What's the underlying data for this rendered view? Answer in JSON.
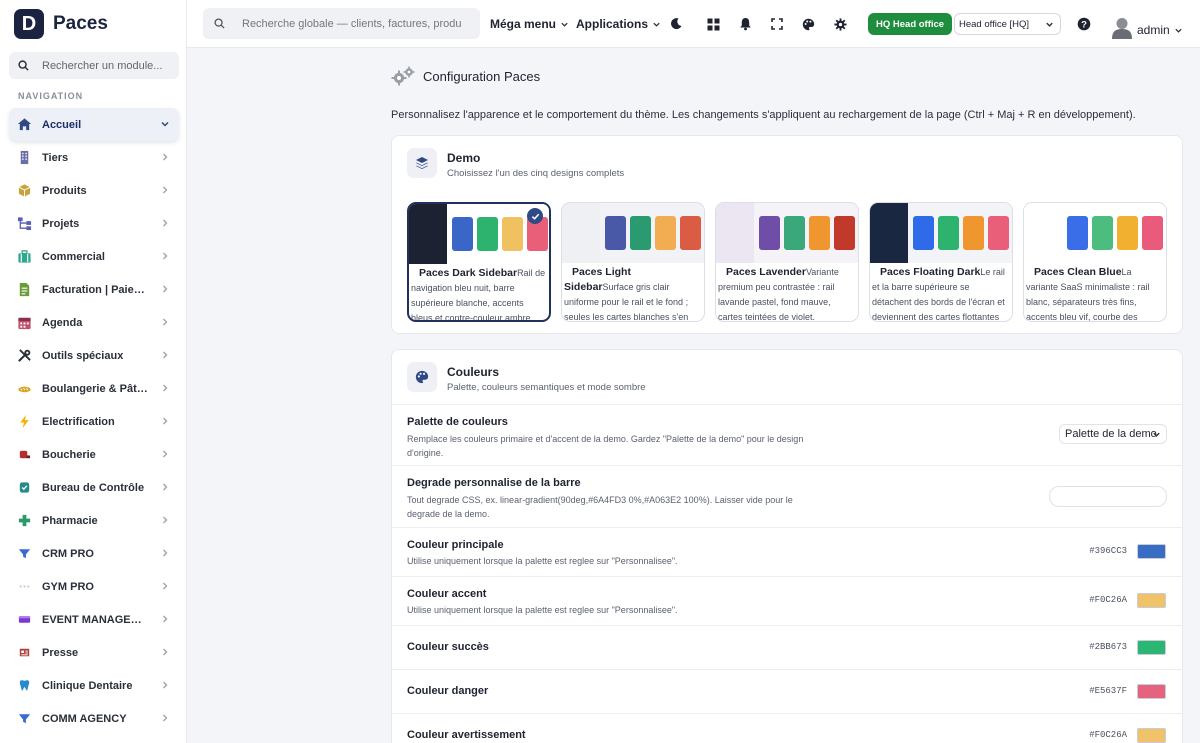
{
  "brand": {
    "logo_letter": "D",
    "name": "Paces"
  },
  "sidebar": {
    "search_placeholder": "Rechercher un module...",
    "section_label": "NAVIGATION",
    "items": [
      {
        "label": "Accueil",
        "icon": "home-icon",
        "color": "#2f4a86"
      },
      {
        "label": "Tiers",
        "icon": "building-icon",
        "color": "#6b6fa8"
      },
      {
        "label": "Produits",
        "icon": "box-icon",
        "color": "#c8a23a"
      },
      {
        "label": "Projets",
        "icon": "sitemap-icon",
        "color": "#5a5fb0"
      },
      {
        "label": "Commercial",
        "icon": "briefcase-icon",
        "color": "#2fa98e"
      },
      {
        "label": "Facturation | Paiement",
        "icon": "invoice-icon",
        "color": "#6a9c3a"
      },
      {
        "label": "Agenda",
        "icon": "calendar-icon",
        "color": "#c0506a"
      },
      {
        "label": "Outils spéciaux",
        "icon": "tools-icon",
        "color": "#2a2f3a"
      },
      {
        "label": "Boulangerie & Pâtisserie",
        "icon": "bread-icon",
        "color": "#d9a520"
      },
      {
        "label": "Electrification",
        "icon": "bolt-icon",
        "color": "#f2b400"
      },
      {
        "label": "Boucherie",
        "icon": "meat-icon",
        "color": "#b03030"
      },
      {
        "label": "Bureau de Contrôle",
        "icon": "shield-icon",
        "color": "#2a8a8a"
      },
      {
        "label": "Pharmacie",
        "icon": "plus-cross-icon",
        "color": "#2a9a6a"
      },
      {
        "label": "CRM PRO",
        "icon": "funnel-icon",
        "color": "#3a6ad0"
      },
      {
        "label": "GYM PRO",
        "icon": "dots-icon",
        "color": "#c8ccd6"
      },
      {
        "label": "EVENT MANAGEMENT",
        "icon": "ticket-icon",
        "color": "#7a3ad0"
      },
      {
        "label": "Presse",
        "icon": "newspaper-icon",
        "color": "#b04040"
      },
      {
        "label": "Clinique Dentaire",
        "icon": "tooth-icon",
        "color": "#2a8ad0"
      },
      {
        "label": "COMM AGENCY",
        "icon": "filter-icon",
        "color": "#3a6ad0"
      }
    ]
  },
  "topbar": {
    "search_placeholder": "Recherche globale — clients, factures, produits…",
    "mega_menu": "Méga menu",
    "applications": "Applications",
    "icons": [
      "moon-icon",
      "grid-icon",
      "bell-icon",
      "fullscreen-icon",
      "palette-icon",
      "gear-icon"
    ],
    "entity_badge": "HQ Head office",
    "entity_select": "Head office [HQ]",
    "user": "admin"
  },
  "page": {
    "title": "Configuration Paces",
    "description": "Personnalisez l'apparence et le comportement du thème. Les changements s'appliquent au rechargement de la page (Ctrl + Maj + R en développement)."
  },
  "demo": {
    "title": "Demo",
    "subtitle": "Choisissez l'un des cinq designs complets",
    "designs": [
      {
        "name": "Paces Dark Sidebar",
        "desc": "Rail de navigation bleu nuit, barre supérieure blanche, accents bleus et contre-couleur ambre.",
        "rail": "#1c2231",
        "bg": "#ffffff",
        "swatches": [
          "#3a67c7",
          "#2eb36f",
          "#f0c160",
          "#e95f7a"
        ],
        "selected": true
      },
      {
        "name": "Paces Light Sidebar",
        "desc": "Surface gris clair uniforme pour le rail et le fond ; seules les cartes blanches s'en détachent. Indigo et orange.",
        "rail": "#eef0f4",
        "bg": "#f2f3f6",
        "swatches": [
          "#4a58a8",
          "#2a9a70",
          "#f2ad52",
          "#db5c45"
        ],
        "selected": false
      },
      {
        "name": "Paces Lavender",
        "desc": "Variante premium peu contrastée : rail lavande pastel, fond mauve, cartes teintées de violet.",
        "rail": "#ece6f2",
        "bg": "#f5f2f8",
        "swatches": [
          "#6f4ea8",
          "#3aa87a",
          "#f0962e",
          "#c0392b"
        ],
        "selected": false
      },
      {
        "name": "Paces Floating Dark",
        "desc": "Le rail et la barre supérieure se détachent des bords de l'écran et deviennent des cartes flottantes arrondies.",
        "rail": "#1a2740",
        "bg": "#f2f4f8",
        "swatches": [
          "#2f6ae8",
          "#2eb36f",
          "#f0962e",
          "#e95f7a"
        ],
        "selected": false
      },
      {
        "name": "Paces Clean Blue",
        "desc": "La variante SaaS minimaliste : rail blanc, séparateurs très fins, accents bleu vif, courbe des ventes verte.",
        "rail": "#ffffff",
        "bg": "#ffffff",
        "swatches": [
          "#3a6ee8",
          "#4cbd7e",
          "#f2b030",
          "#ea5a7a"
        ],
        "selected": false
      }
    ]
  },
  "colors": {
    "title": "Couleurs",
    "subtitle": "Palette, couleurs semantiques et mode sombre",
    "palette_label": "Palette de couleurs",
    "palette_desc": "Remplace les couleurs primaire et d'accent de la demo. Gardez \"Palette de la demo\" pour le design d'origine.",
    "palette_value": "Palette de la demo",
    "gradient_label": "Degrade personnalise de la barre",
    "gradient_desc": "Tout degrade CSS, ex. linear-gradient(90deg,#6A4FD3 0%,#A063E2 100%). Laisser vide pour le degrade de la demo.",
    "gradient_value": "",
    "items": [
      {
        "label": "Couleur principale",
        "desc": "Utilise uniquement lorsque la palette est reglee sur \"Personnalisee\".",
        "hex": "#396CC3"
      },
      {
        "label": "Couleur accent",
        "desc": "Utilise uniquement lorsque la palette est reglee sur \"Personnalisee\".",
        "hex": "#F0C26A"
      },
      {
        "label": "Couleur succès",
        "desc": "",
        "hex": "#2BB673"
      },
      {
        "label": "Couleur danger",
        "desc": "",
        "hex": "#E5637F"
      },
      {
        "label": "Couleur avertissement",
        "desc": "",
        "hex": "#F0C26A"
      }
    ]
  }
}
